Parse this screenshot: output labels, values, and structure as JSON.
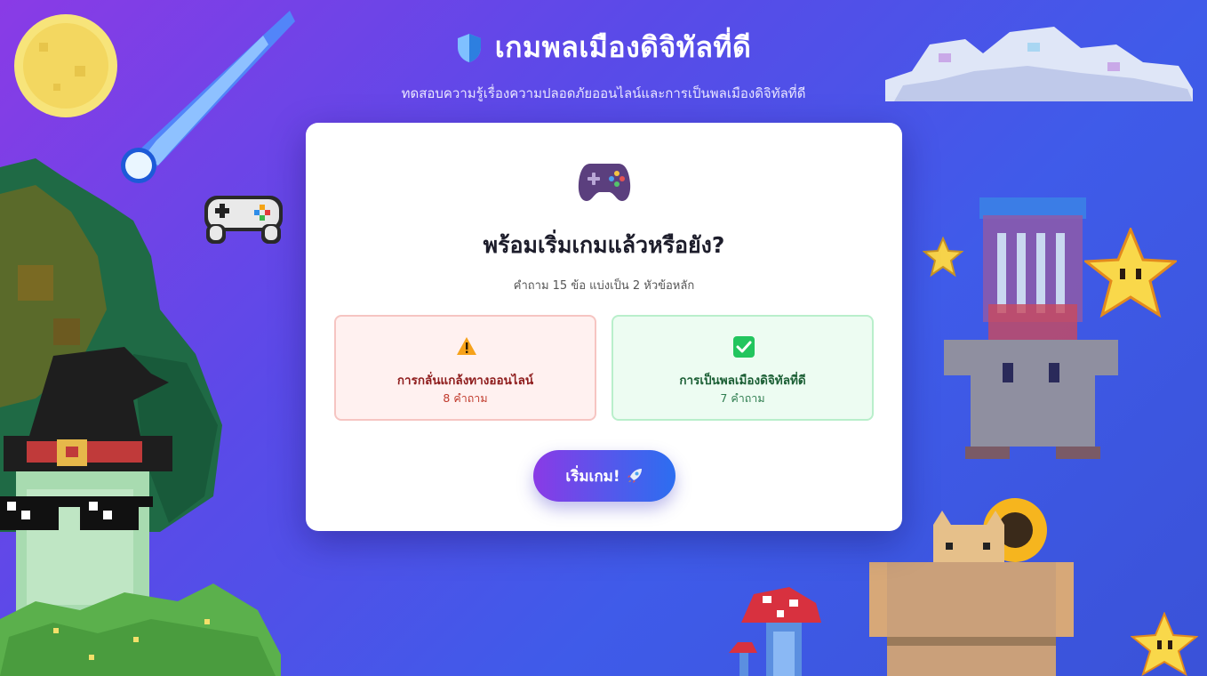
{
  "header": {
    "title": "เกมพลเมืองดิจิทัลที่ดี",
    "subtitle": "ทดสอบความรู้เรื่องความปลอดภัยออนไลน์และการเป็นพลเมืองดิจิทัลที่ดี",
    "icon": "shield-icon"
  },
  "card": {
    "icon": "game-controller-icon",
    "title": "พร้อมเริ่มเกมแล้วหรือยัง?",
    "subtitle": "คำถาม 15 ข้อ แบ่งเป็น 2 หัวข้อหลัก",
    "topics": [
      {
        "name": "การกลั่นแกล้งทางออนไลน์",
        "count": "8 คำถาม",
        "icon": "warning-icon",
        "color": "#f6a21a"
      },
      {
        "name": "การเป็นพลเมืองดิจิทัลที่ดี",
        "count": "7 คำถาม",
        "icon": "checkmark-icon",
        "color": "#22c55e"
      }
    ],
    "start_button": {
      "label": "เริ่มเกม!",
      "icon": "rocket-icon"
    }
  },
  "colors": {
    "background_start": "#8a3be6",
    "background_end": "#3a52d8",
    "button_start": "#8a3ae6",
    "button_end": "#2c6ef0"
  }
}
